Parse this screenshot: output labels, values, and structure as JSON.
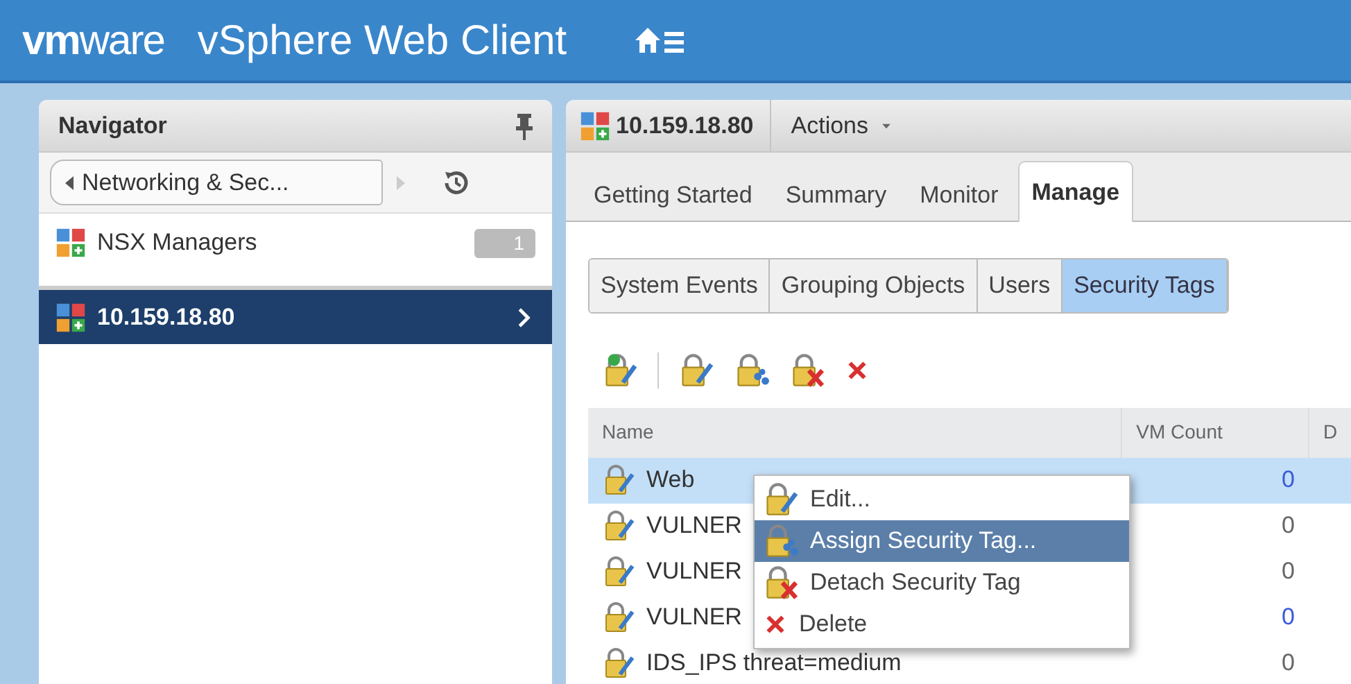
{
  "header": {
    "logo_bold": "vm",
    "logo_rest": "ware",
    "title": "vSphere Web Client"
  },
  "navigator": {
    "title": "Navigator",
    "back_label": "Networking & Sec...",
    "items": [
      {
        "label": "NSX Managers",
        "count": "1",
        "selected": false
      },
      {
        "label": "10.159.18.80",
        "selected": true
      }
    ]
  },
  "object": {
    "name": "10.159.18.80",
    "actions": "Actions"
  },
  "tabs": [
    {
      "label": "Getting Started",
      "selected": false
    },
    {
      "label": "Summary",
      "selected": false
    },
    {
      "label": "Monitor",
      "selected": false
    },
    {
      "label": "Manage",
      "selected": true
    }
  ],
  "subtabs": [
    {
      "label": "System Events",
      "selected": false
    },
    {
      "label": "Grouping Objects",
      "selected": false
    },
    {
      "label": "Users",
      "selected": false
    },
    {
      "label": "Security Tags",
      "selected": true
    }
  ],
  "toolbar": [
    {
      "kind": "new"
    },
    {
      "kind": "edit"
    },
    {
      "kind": "assign"
    },
    {
      "kind": "detach"
    },
    {
      "kind": "delete"
    }
  ],
  "table": {
    "columns": [
      "Name",
      "VM Count",
      "D"
    ],
    "rows": [
      {
        "name": "Web",
        "vm_count": "0",
        "selected": true,
        "linked": true
      },
      {
        "name": "VULNER",
        "vm_count": "0",
        "selected": false,
        "linked": false
      },
      {
        "name": "VULNER",
        "vm_count": "0",
        "selected": false,
        "linked": false
      },
      {
        "name": "VULNER",
        "vm_count": "0",
        "selected": false,
        "linked": true
      },
      {
        "name": "IDS_IPS threat=medium",
        "vm_count": "0",
        "selected": false,
        "linked": false
      }
    ]
  },
  "context_menu": {
    "items": [
      {
        "kind": "edit",
        "label": "Edit...",
        "selected": false
      },
      {
        "kind": "assign",
        "label": "Assign Security Tag...",
        "selected": true
      },
      {
        "kind": "detach",
        "label": "Detach Security Tag",
        "selected": false
      },
      {
        "kind": "delete",
        "label": "Delete",
        "selected": false
      }
    ]
  }
}
